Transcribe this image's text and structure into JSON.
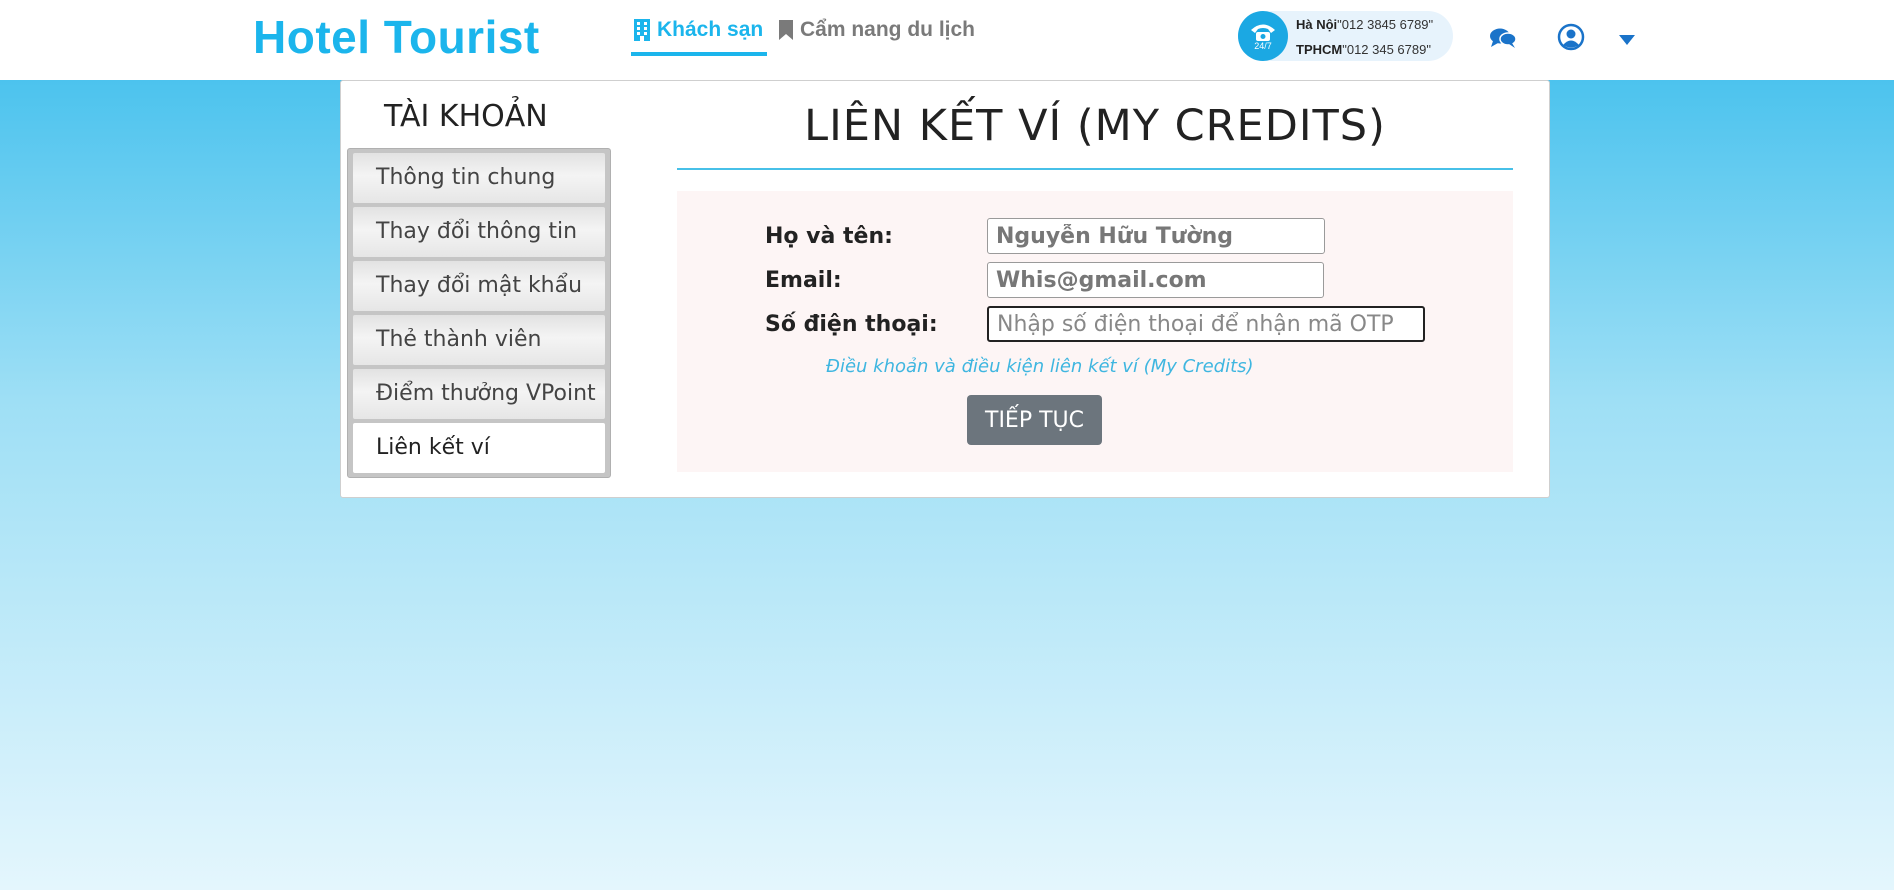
{
  "header": {
    "logo": "Hotel Tourist",
    "nav": [
      {
        "label": "Khách sạn",
        "icon": "building-icon",
        "active": true
      },
      {
        "label": "Cẩm nang du lịch",
        "icon": "bookmark-icon",
        "active": false
      }
    ],
    "hotline": {
      "badge": "24/7",
      "lines": [
        {
          "city": "Hà Nội",
          "number": "\"012 3845 6789\""
        },
        {
          "city": "TPHCM",
          "number": "\"012 345 6789\""
        }
      ]
    },
    "icons": [
      "chat-icon",
      "user-icon",
      "caret-down-icon"
    ]
  },
  "sidebar": {
    "title": "TÀI KHOẢN",
    "items": [
      {
        "label": "Thông tin chung"
      },
      {
        "label": "Thay đổi thông tin"
      },
      {
        "label": "Thay đổi mật khẩu"
      },
      {
        "label": "Thẻ thành viên"
      },
      {
        "label": "Điểm thưởng VPoint"
      },
      {
        "label": "Liên kết ví",
        "active": true
      }
    ]
  },
  "main": {
    "title": "LIÊN KẾT VÍ (MY CREDITS)",
    "form": {
      "name_label": "Họ và tên:",
      "name_value": "Nguyễn Hữu Tường",
      "email_label": "Email:",
      "email_value": "Whis@gmail.com",
      "phone_label": "Số điện thoại:",
      "phone_placeholder": "Nhập số điện thoại để nhận mã OTP",
      "terms": "Điều khoản và điều kiện liên kết ví (My Credits)",
      "submit": "TIẾP TỤC"
    }
  },
  "colors": {
    "brand": "#1bb5ec",
    "button": "#6c757d",
    "rule": "#47c0e8"
  }
}
